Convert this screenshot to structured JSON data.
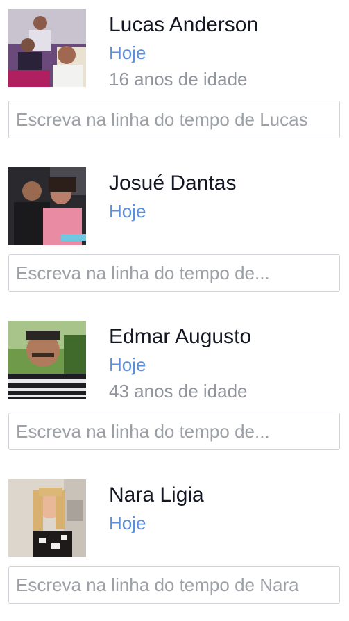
{
  "birthdays": [
    {
      "name": "Lucas Anderson",
      "when": "Hoje",
      "age": "16 anos de idade",
      "placeholder": "Escreva na linha do tempo de Lucas"
    },
    {
      "name": "Josué Dantas",
      "when": "Hoje",
      "age": "",
      "placeholder": "Escreva na linha do tempo de..."
    },
    {
      "name": "Edmar Augusto",
      "when": "Hoje",
      "age": "43 anos de idade",
      "placeholder": "Escreva na linha do tempo de..."
    },
    {
      "name": "Nara Ligia",
      "when": "Hoje",
      "age": "",
      "placeholder": "Escreva na linha do tempo de Nara"
    }
  ],
  "colors": {
    "link_blue": "#5b8fd9",
    "name_text": "#141823",
    "secondary_text": "#90949c",
    "input_border": "#cfd2d6"
  }
}
